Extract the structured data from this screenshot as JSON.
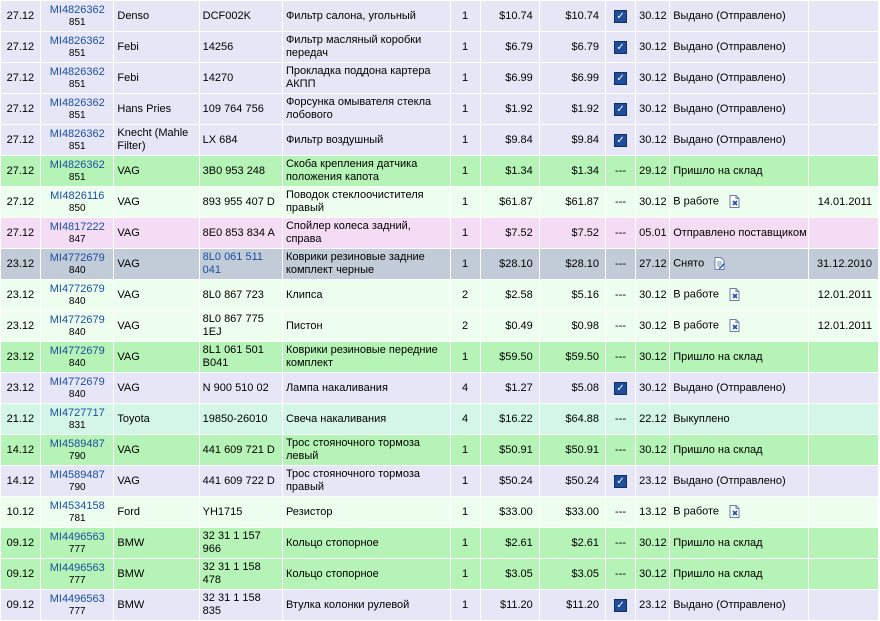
{
  "rows": [
    {
      "date": "27.12",
      "order": "MI4826362",
      "sub": "851",
      "brand": "Denso",
      "code": "DCF002K",
      "code_link": false,
      "desc": "Фильтр салона, угольный",
      "qty": "1",
      "price": "$10.74",
      "sum": "$10.74",
      "check": "checkbox",
      "dash": "",
      "date2": "30.12",
      "status": "Выдано (Отправлено)",
      "status_icon": "",
      "last": "",
      "color": "gray"
    },
    {
      "date": "27.12",
      "order": "MI4826362",
      "sub": "851",
      "brand": "Febi",
      "code": "14256",
      "code_link": false,
      "desc": "Фильтр масляный коробки передач",
      "qty": "1",
      "price": "$6.79",
      "sum": "$6.79",
      "check": "checkbox",
      "dash": "",
      "date2": "30.12",
      "status": "Выдано (Отправлено)",
      "status_icon": "",
      "last": "",
      "color": "gray"
    },
    {
      "date": "27.12",
      "order": "MI4826362",
      "sub": "851",
      "brand": "Febi",
      "code": "14270",
      "code_link": false,
      "desc": "Прокладка поддона картера АКПП",
      "qty": "1",
      "price": "$6.99",
      "sum": "$6.99",
      "check": "checkbox",
      "dash": "",
      "date2": "30.12",
      "status": "Выдано (Отправлено)",
      "status_icon": "",
      "last": "",
      "color": "gray"
    },
    {
      "date": "27.12",
      "order": "MI4826362",
      "sub": "851",
      "brand": "Hans Pries",
      "code": "109 764 756",
      "code_link": false,
      "desc": "Форсунка омывателя стекла лобового",
      "qty": "1",
      "price": "$1.92",
      "sum": "$1.92",
      "check": "checkbox",
      "dash": "",
      "date2": "30.12",
      "status": "Выдано (Отправлено)",
      "status_icon": "",
      "last": "",
      "color": "gray"
    },
    {
      "date": "27.12",
      "order": "MI4826362",
      "sub": "851",
      "brand": "Knecht (Mahle Filter)",
      "code": "LX 684",
      "code_link": false,
      "desc": "Фильтр воздушный",
      "qty": "1",
      "price": "$9.84",
      "sum": "$9.84",
      "check": "checkbox",
      "dash": "",
      "date2": "30.12",
      "status": "Выдано (Отправлено)",
      "status_icon": "",
      "last": "",
      "color": "gray"
    },
    {
      "date": "27.12",
      "order": "MI4826362",
      "sub": "851",
      "brand": "VAG",
      "code": "3B0 953 248",
      "code_link": false,
      "desc": "Скоба крепления датчика положения капота",
      "qty": "1",
      "price": "$1.34",
      "sum": "$1.34",
      "check": "",
      "dash": "---",
      "date2": "29.12",
      "status": "Пришло на склад",
      "status_icon": "",
      "last": "",
      "color": "green"
    },
    {
      "date": "27.12",
      "order": "MI4826116",
      "sub": "850",
      "brand": "VAG",
      "code": "893 955 407 D",
      "code_link": false,
      "desc": "Поводок стеклоочистителя правый",
      "qty": "1",
      "price": "$61.87",
      "sum": "$61.87",
      "check": "",
      "dash": "---",
      "date2": "30.12",
      "status": "В работе",
      "status_icon": "cancel-doc-icon",
      "last": "14.01.2011",
      "color": "light"
    },
    {
      "date": "27.12",
      "order": "MI4817222",
      "sub": "847",
      "brand": "VAG",
      "code": "8E0 853 834 A",
      "code_link": false,
      "desc": "Спойлер колеса задний, справа",
      "qty": "1",
      "price": "$7.52",
      "sum": "$7.52",
      "check": "",
      "dash": "---",
      "date2": "05.01",
      "status": "Отправлено поставщиком",
      "status_icon": "",
      "last": "",
      "color": "pink"
    },
    {
      "date": "23.12",
      "order": "MI4772679",
      "sub": "840",
      "brand": "VAG",
      "code": "8L0 061 511 041",
      "code_link": true,
      "desc": "Коврики резиновые задние комплект черные",
      "qty": "1",
      "price": "$28.10",
      "sum": "$28.10",
      "check": "",
      "dash": "---",
      "date2": "27.12",
      "status": "Снято",
      "status_icon": "edit-doc-icon",
      "last": "31.12.2010",
      "color": "sel"
    },
    {
      "date": "23.12",
      "order": "MI4772679",
      "sub": "840",
      "brand": "VAG",
      "code": "8L0 867 723",
      "code_link": false,
      "desc": "Клипса",
      "qty": "2",
      "price": "$2.58",
      "sum": "$5.16",
      "check": "",
      "dash": "---",
      "date2": "30.12",
      "status": "В работе",
      "status_icon": "cancel-doc-icon",
      "last": "12.01.2011",
      "color": "light"
    },
    {
      "date": "23.12",
      "order": "MI4772679",
      "sub": "840",
      "brand": "VAG",
      "code": "8L0 867 775 1EJ",
      "code_link": false,
      "desc": "Пистон",
      "qty": "2",
      "price": "$0.49",
      "sum": "$0.98",
      "check": "",
      "dash": "---",
      "date2": "30.12",
      "status": "В работе",
      "status_icon": "cancel-doc-icon",
      "last": "12.01.2011",
      "color": "light"
    },
    {
      "date": "23.12",
      "order": "MI4772679",
      "sub": "840",
      "brand": "VAG",
      "code": "8L1 061 501 B041",
      "code_link": false,
      "desc": "Коврики резиновые передние комплект",
      "qty": "1",
      "price": "$59.50",
      "sum": "$59.50",
      "check": "",
      "dash": "---",
      "date2": "30.12",
      "status": "Пришло на склад",
      "status_icon": "",
      "last": "",
      "color": "green"
    },
    {
      "date": "23.12",
      "order": "MI4772679",
      "sub": "840",
      "brand": "VAG",
      "code": "N 900 510 02",
      "code_link": false,
      "desc": "Лампа накаливания",
      "qty": "4",
      "price": "$1.27",
      "sum": "$5.08",
      "check": "checkbox",
      "dash": "",
      "date2": "30.12",
      "status": "Выдано (Отправлено)",
      "status_icon": "",
      "last": "",
      "color": "gray"
    },
    {
      "date": "21.12",
      "order": "MI4727717",
      "sub": "831",
      "brand": "Toyota",
      "code": "19850-26010",
      "code_link": false,
      "desc": "Свеча накаливания",
      "qty": "4",
      "price": "$16.22",
      "sum": "$64.88",
      "check": "",
      "dash": "---",
      "date2": "22.12",
      "status": "Выкуплено",
      "status_icon": "",
      "last": "",
      "color": "teal"
    },
    {
      "date": "14.12",
      "order": "MI4589487",
      "sub": "790",
      "brand": "VAG",
      "code": "441 609 721 D",
      "code_link": false,
      "desc": "Трос стояночного тормоза левый",
      "qty": "1",
      "price": "$50.91",
      "sum": "$50.91",
      "check": "",
      "dash": "---",
      "date2": "30.12",
      "status": "Пришло на склад",
      "status_icon": "",
      "last": "",
      "color": "green"
    },
    {
      "date": "14.12",
      "order": "MI4589487",
      "sub": "790",
      "brand": "VAG",
      "code": "441 609 722 D",
      "code_link": false,
      "desc": "Трос стояночного тормоза правый",
      "qty": "1",
      "price": "$50.24",
      "sum": "$50.24",
      "check": "checkbox",
      "dash": "",
      "date2": "23.12",
      "status": "Выдано (Отправлено)",
      "status_icon": "",
      "last": "",
      "color": "gray"
    },
    {
      "date": "10.12",
      "order": "MI4534158",
      "sub": "781",
      "brand": "Ford",
      "code": "YH1715",
      "code_link": false,
      "desc": "Резистор",
      "qty": "1",
      "price": "$33.00",
      "sum": "$33.00",
      "check": "",
      "dash": "---",
      "date2": "13.12",
      "status": "В работе",
      "status_icon": "cancel-doc-icon",
      "last": "",
      "color": "light"
    },
    {
      "date": "09.12",
      "order": "MI4496563",
      "sub": "777",
      "brand": "BMW",
      "code": "32 31 1 157 966",
      "code_link": false,
      "desc": "Кольцо стопорное",
      "qty": "1",
      "price": "$2.61",
      "sum": "$2.61",
      "check": "",
      "dash": "---",
      "date2": "30.12",
      "status": "Пришло на склад",
      "status_icon": "",
      "last": "",
      "color": "green"
    },
    {
      "date": "09.12",
      "order": "MI4496563",
      "sub": "777",
      "brand": "BMW",
      "code": "32 31 1 158 478",
      "code_link": false,
      "desc": "Кольцо стопорное",
      "qty": "1",
      "price": "$3.05",
      "sum": "$3.05",
      "check": "",
      "dash": "---",
      "date2": "30.12",
      "status": "Пришло на склад",
      "status_icon": "",
      "last": "",
      "color": "green"
    },
    {
      "date": "09.12",
      "order": "MI4496563",
      "sub": "777",
      "brand": "BMW",
      "code": "32 31 1 158 835",
      "code_link": false,
      "desc": "Втулка колонки рулевой",
      "qty": "1",
      "price": "$11.20",
      "sum": "$11.20",
      "check": "checkbox",
      "dash": "",
      "date2": "23.12",
      "status": "Выдано (Отправлено)",
      "status_icon": "",
      "last": "",
      "color": "gray"
    }
  ]
}
